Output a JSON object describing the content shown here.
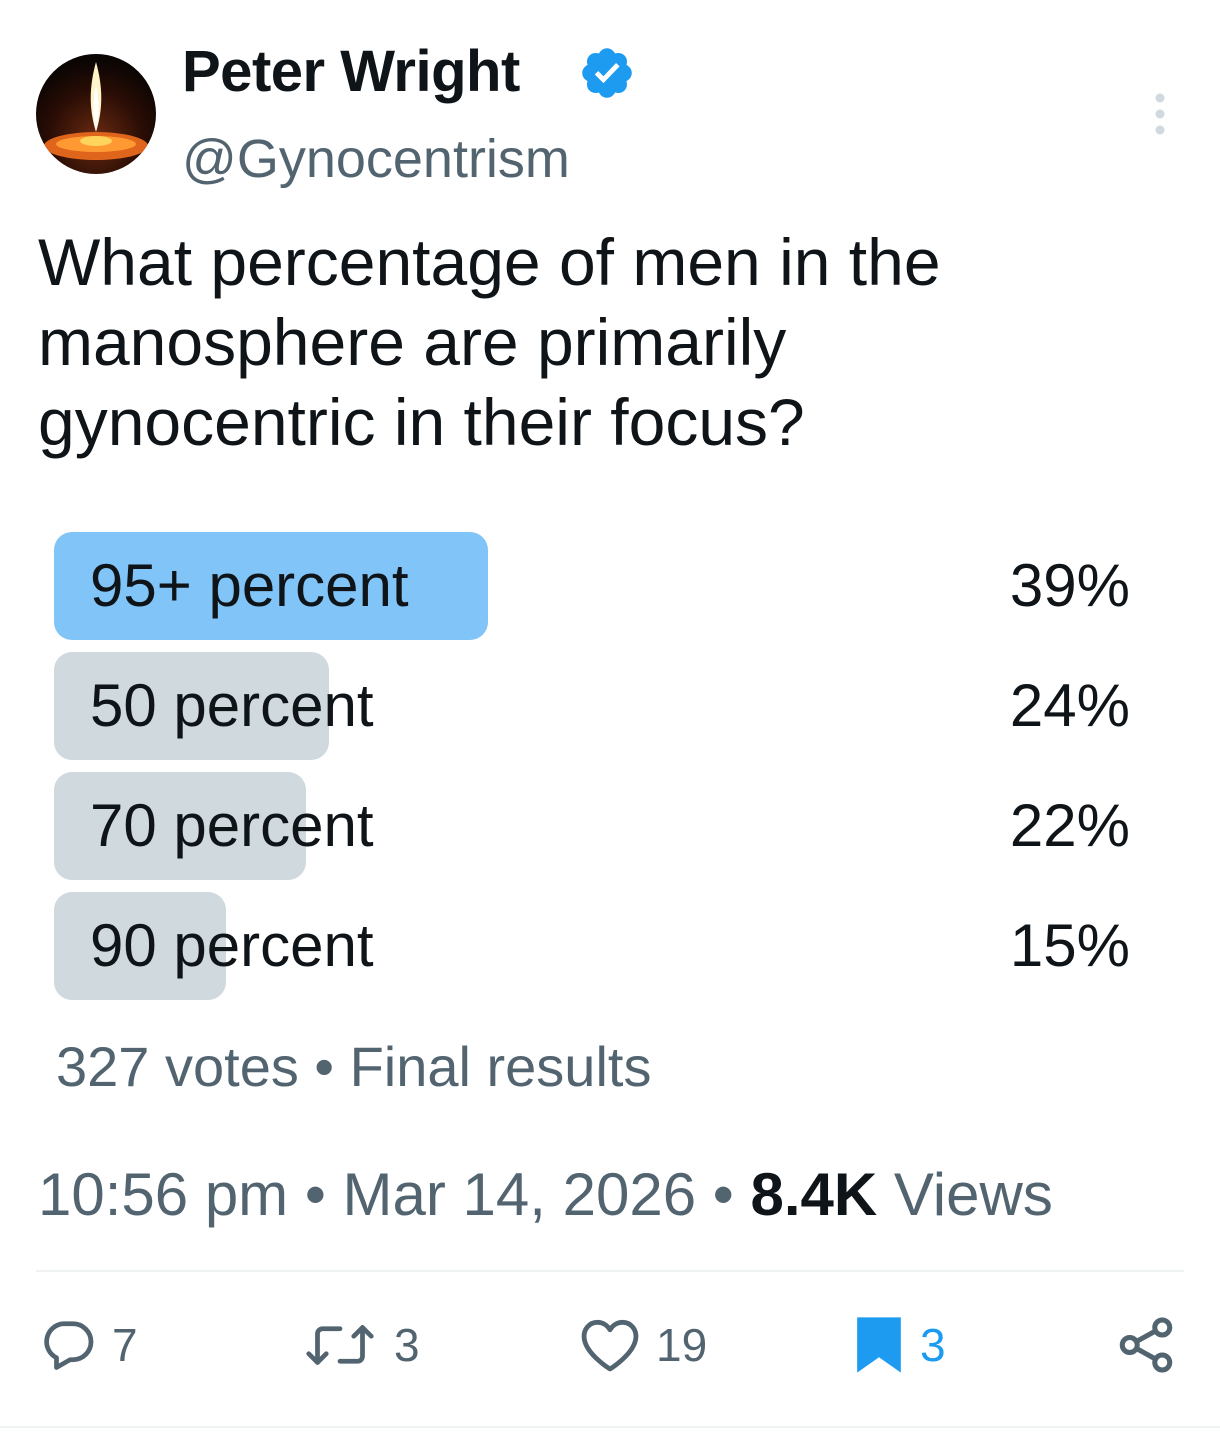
{
  "author": {
    "name": "Peter Wright",
    "handle": "@Gynocentrism",
    "verified": true,
    "avatar_icon": "candle-flame-avatar"
  },
  "post": {
    "text_lines": [
      "What percentage of men in the",
      "manosphere are primarily",
      "gynocentric in their focus?"
    ]
  },
  "poll": {
    "options": [
      {
        "label": "95+ percent",
        "percent_text": "39%",
        "percent": 39,
        "winner": true
      },
      {
        "label": "50 percent",
        "percent_text": "24%",
        "percent": 24,
        "winner": false
      },
      {
        "label": "70 percent",
        "percent_text": "22%",
        "percent": 22,
        "winner": false
      },
      {
        "label": "90 percent",
        "percent_text": "15%",
        "percent": 15,
        "winner": false
      }
    ],
    "votes": "327 votes",
    "separator": "•",
    "status": "Final results"
  },
  "meta": {
    "time": "10:56 pm",
    "date": "Mar 14, 2026",
    "views_count": "8.4K",
    "views_label": "Views",
    "separator": "•"
  },
  "actions": {
    "replies": "7",
    "reposts": "3",
    "likes": "19",
    "bookmarks": "3",
    "bookmarked": true
  },
  "colors": {
    "accent": "#1d9bf0",
    "poll_winner": "#80c4f8",
    "poll_other": "#cfd9de",
    "secondary_text": "#536471"
  }
}
